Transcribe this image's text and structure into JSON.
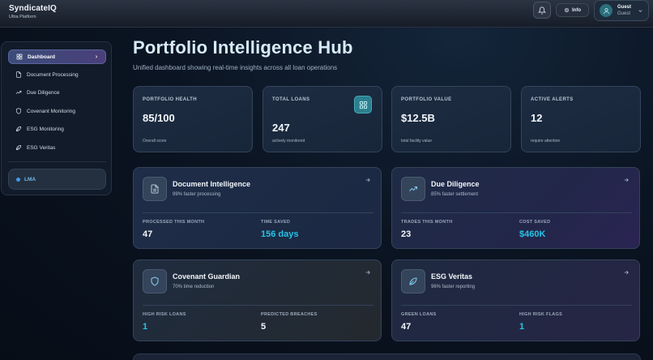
{
  "brand": {
    "name": "SyndicateIQ",
    "subtitle": "Ultra Platform"
  },
  "topbar": {
    "info_label": "Info",
    "user": {
      "name": "Guest",
      "role": "Guest"
    }
  },
  "sidebar": {
    "items": [
      {
        "label": "Dashboard",
        "icon": "dashboard-grid-icon",
        "active": true
      },
      {
        "label": "Document Processing",
        "icon": "document-icon"
      },
      {
        "label": "Due Diligence",
        "icon": "trend-up-icon"
      },
      {
        "label": "Covenant Monitoring",
        "icon": "shield-icon"
      },
      {
        "label": "ESG Monitoring",
        "icon": "leaf-icon"
      },
      {
        "label": "ESG Veritas",
        "icon": "leaf-icon"
      }
    ],
    "lma_label": "LMA"
  },
  "header": {
    "title": "Portfolio Intelligence Hub",
    "subtitle": "Unified dashboard showing real-time insights across all loan operations"
  },
  "stats": [
    {
      "label": "PORTFOLIO HEALTH",
      "value": "85/100",
      "note": "Overall score"
    },
    {
      "label": "TOTAL LOANS",
      "value": "247",
      "note": "actively monitored",
      "icon": "grid-icon"
    },
    {
      "label": "PORTFOLIO VALUE",
      "value": "$12.5B",
      "note": "total facility value"
    },
    {
      "label": "ACTIVE ALERTS",
      "value": "12",
      "note": "require attention"
    }
  ],
  "features": [
    {
      "title": "Document Intelligence",
      "subtitle": "99% faster processing",
      "icon": "document-icon",
      "metrics": [
        {
          "label": "PROCESSED THIS MONTH",
          "value": "47"
        },
        {
          "label": "TIME SAVED",
          "value": "156 days"
        }
      ]
    },
    {
      "title": "Due Diligence",
      "subtitle": "85% faster settlement",
      "icon": "trend-up-icon",
      "metrics": [
        {
          "label": "TRADES THIS MONTH",
          "value": "23"
        },
        {
          "label": "COST SAVED",
          "value": "$460K"
        }
      ]
    },
    {
      "title": "Covenant Guardian",
      "subtitle": "70% time reduction",
      "icon": "shield-icon",
      "metrics": [
        {
          "label": "HIGH RISK LOANS",
          "value": "1"
        },
        {
          "label": "PREDICTED BREACHES",
          "value": "5"
        }
      ]
    },
    {
      "title": "ESG Veritas",
      "subtitle": "96% faster reporting",
      "icon": "leaf-icon",
      "metrics": [
        {
          "label": "GREEN LOANS",
          "value": "47"
        },
        {
          "label": "HIGH RISK FLAGS",
          "value": "1"
        }
      ]
    }
  ],
  "colors": {
    "accent": "#27c3e6",
    "sidebar_active": "#4a3f7a",
    "lma": "#3e9be6"
  }
}
